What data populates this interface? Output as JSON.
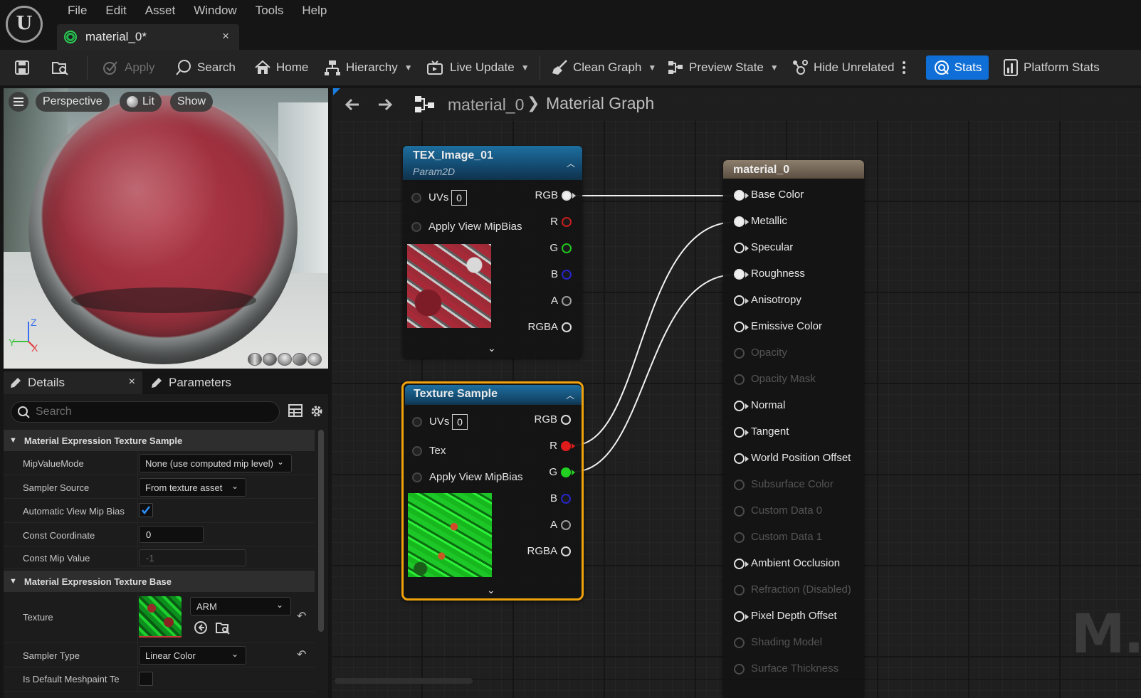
{
  "app": {
    "logo_text": "U",
    "menu": [
      "File",
      "Edit",
      "Asset",
      "Window",
      "Tools",
      "Help"
    ],
    "tab": {
      "label": "material_0*",
      "close": "×"
    }
  },
  "toolbar": {
    "apply": "Apply",
    "search": "Search",
    "home": "Home",
    "hierarchy": "Hierarchy",
    "live_update": "Live Update",
    "clean_graph": "Clean Graph",
    "preview_state": "Preview State",
    "hide_unrelated": "Hide Unrelated",
    "stats": "Stats",
    "platform_stats": "Platform Stats",
    "accent": "#0f6fd6"
  },
  "viewport": {
    "perspective": "Perspective",
    "lit": "Lit",
    "show": "Show",
    "axis_z": "Z",
    "axis_y": "Y",
    "axis_x": "X"
  },
  "details": {
    "tab_details": "Details",
    "tab_params": "Parameters",
    "close": "×",
    "search_placeholder": "Search",
    "cat1": "Material Expression Texture Sample",
    "cat2": "Material Expression Texture Base",
    "rows": {
      "mip_mode": {
        "name": "MipValueMode",
        "value": "None (use computed mip level)"
      },
      "sampler_source": {
        "name": "Sampler Source",
        "value": "From texture asset"
      },
      "auto_mip_bias": {
        "name": "Automatic View Mip Bias",
        "checked": true
      },
      "const_coord": {
        "name": "Const Coordinate",
        "value": "0"
      },
      "const_mip": {
        "name": "Const Mip Value",
        "value": "-1"
      },
      "texture": {
        "name": "Texture",
        "value": "ARM"
      },
      "sampler_type": {
        "name": "Sampler Type",
        "value": "Linear Color"
      },
      "default_meshpaint": {
        "name": "Is Default Meshpaint Te"
      }
    }
  },
  "graph": {
    "breadcrumb_asset": "material_0",
    "breadcrumb_sep": "❯",
    "breadcrumb_graph": "Material Graph",
    "watermark": "M.",
    "node1": {
      "title": "TEX_Image_01",
      "subtitle": "Param2D",
      "uvs_label": "UVs",
      "uvs_value": "0",
      "mipbias": "Apply View MipBias",
      "outputs": [
        "RGB",
        "R",
        "G",
        "B",
        "A",
        "RGBA"
      ]
    },
    "node2": {
      "title": "Texture Sample",
      "uvs_label": "UVs",
      "uvs_value": "0",
      "tex": "Tex",
      "mipbias": "Apply View MipBias",
      "outputs": [
        "RGB",
        "R",
        "G",
        "B",
        "A",
        "RGBA"
      ]
    },
    "result": {
      "title": "material_0",
      "pins": [
        {
          "label": "Base Color",
          "active": true,
          "connected": true
        },
        {
          "label": "Metallic",
          "active": true,
          "connected": true
        },
        {
          "label": "Specular",
          "active": true,
          "connected": false
        },
        {
          "label": "Roughness",
          "active": true,
          "connected": true
        },
        {
          "label": "Anisotropy",
          "active": true,
          "connected": false
        },
        {
          "label": "Emissive Color",
          "active": true,
          "connected": false
        },
        {
          "label": "Opacity",
          "active": false,
          "connected": false
        },
        {
          "label": "Opacity Mask",
          "active": false,
          "connected": false
        },
        {
          "label": "Normal",
          "active": true,
          "connected": false
        },
        {
          "label": "Tangent",
          "active": true,
          "connected": false
        },
        {
          "label": "World Position Offset",
          "active": true,
          "connected": false
        },
        {
          "label": "Subsurface Color",
          "active": false,
          "connected": false
        },
        {
          "label": "Custom Data 0",
          "active": false,
          "connected": false
        },
        {
          "label": "Custom Data 1",
          "active": false,
          "connected": false
        },
        {
          "label": "Ambient Occlusion",
          "active": true,
          "connected": false
        },
        {
          "label": "Refraction (Disabled)",
          "active": false,
          "connected": false
        },
        {
          "label": "Pixel Depth Offset",
          "active": true,
          "connected": false
        },
        {
          "label": "Shading Model",
          "active": false,
          "connected": false
        },
        {
          "label": "Surface Thickness",
          "active": false,
          "connected": false
        }
      ]
    }
  }
}
